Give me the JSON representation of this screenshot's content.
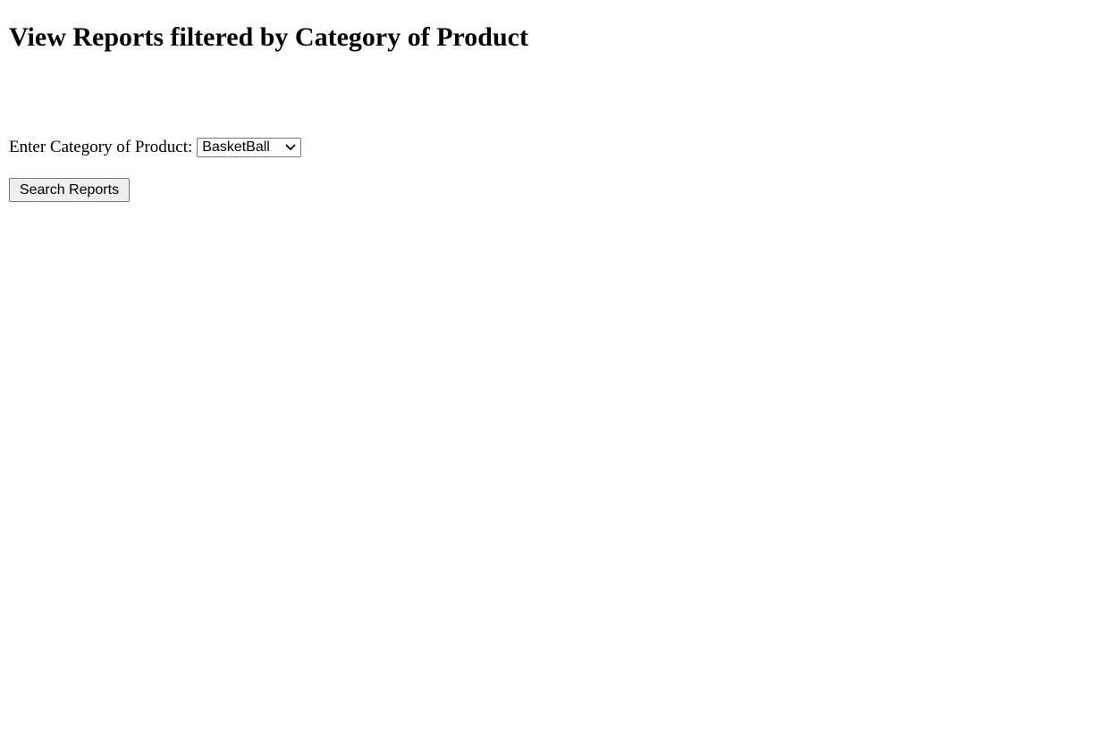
{
  "page": {
    "title": "View Reports filtered by Category of Product"
  },
  "form": {
    "category_label": "Enter Category of Product:",
    "category_selected": "BasketBall",
    "category_icon": "chevron-down-icon",
    "search_button_label": "Search Reports"
  }
}
